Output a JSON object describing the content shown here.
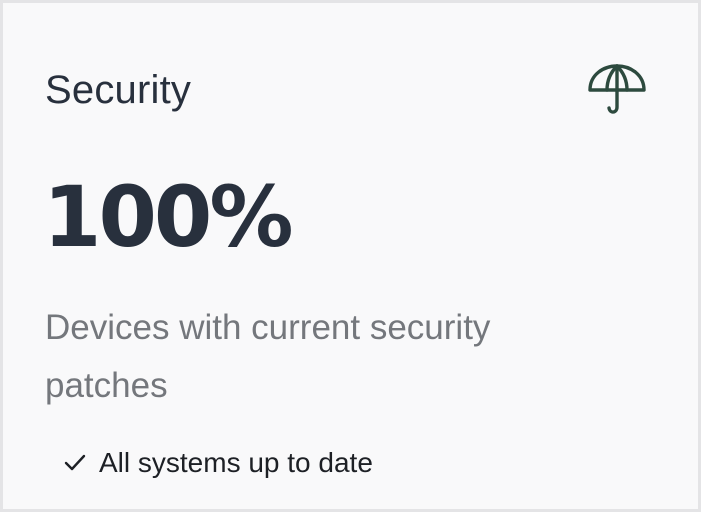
{
  "card": {
    "title": "Security",
    "icon": "umbrella-icon",
    "metric": "100%",
    "description": "Devices with current security patches",
    "status": {
      "icon": "check-icon",
      "text": "All systems up to date"
    }
  },
  "colors": {
    "title": "#28303d",
    "metric": "#28303d",
    "description": "#74777c",
    "icon": "#2d4a3e",
    "card_background": "#f9f9fa",
    "card_border": "#e4e4e6"
  }
}
